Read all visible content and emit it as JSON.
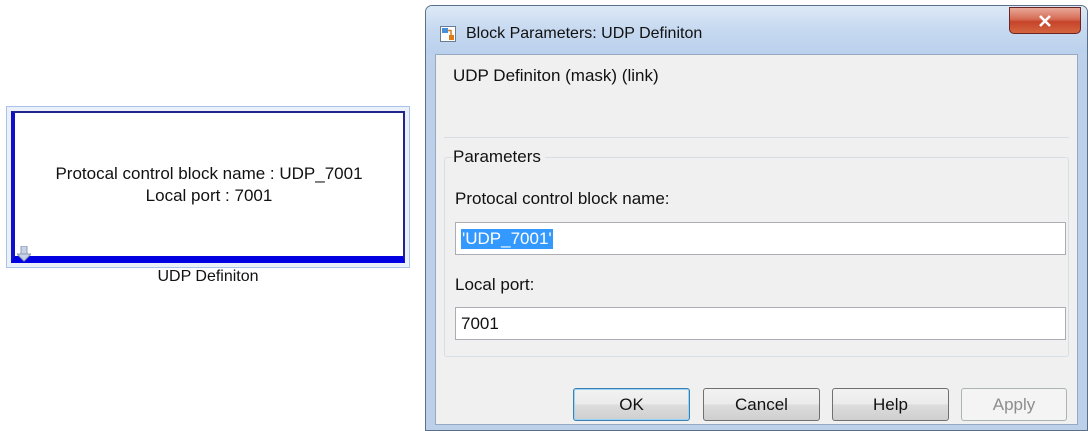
{
  "block": {
    "line1": "Protocal control block name : UDP_7001",
    "line2": "Local port : 7001",
    "caption": "UDP Definiton"
  },
  "dialog": {
    "title": "Block Parameters: UDP Definiton",
    "mask_title": "UDP Definiton (mask) (link)",
    "parameters_label": "Parameters",
    "fields": [
      {
        "label": "Protocal control block name:",
        "value": "'UDP_7001'"
      },
      {
        "label": "Local port:",
        "value": "7001"
      }
    ],
    "buttons": {
      "ok": "OK",
      "cancel": "Cancel",
      "help": "Help",
      "apply": "Apply"
    },
    "close_glyph": "X"
  },
  "colors": {
    "block_border": "#0000e0",
    "selection": "#3399ff",
    "close_button": "#c6442b"
  }
}
